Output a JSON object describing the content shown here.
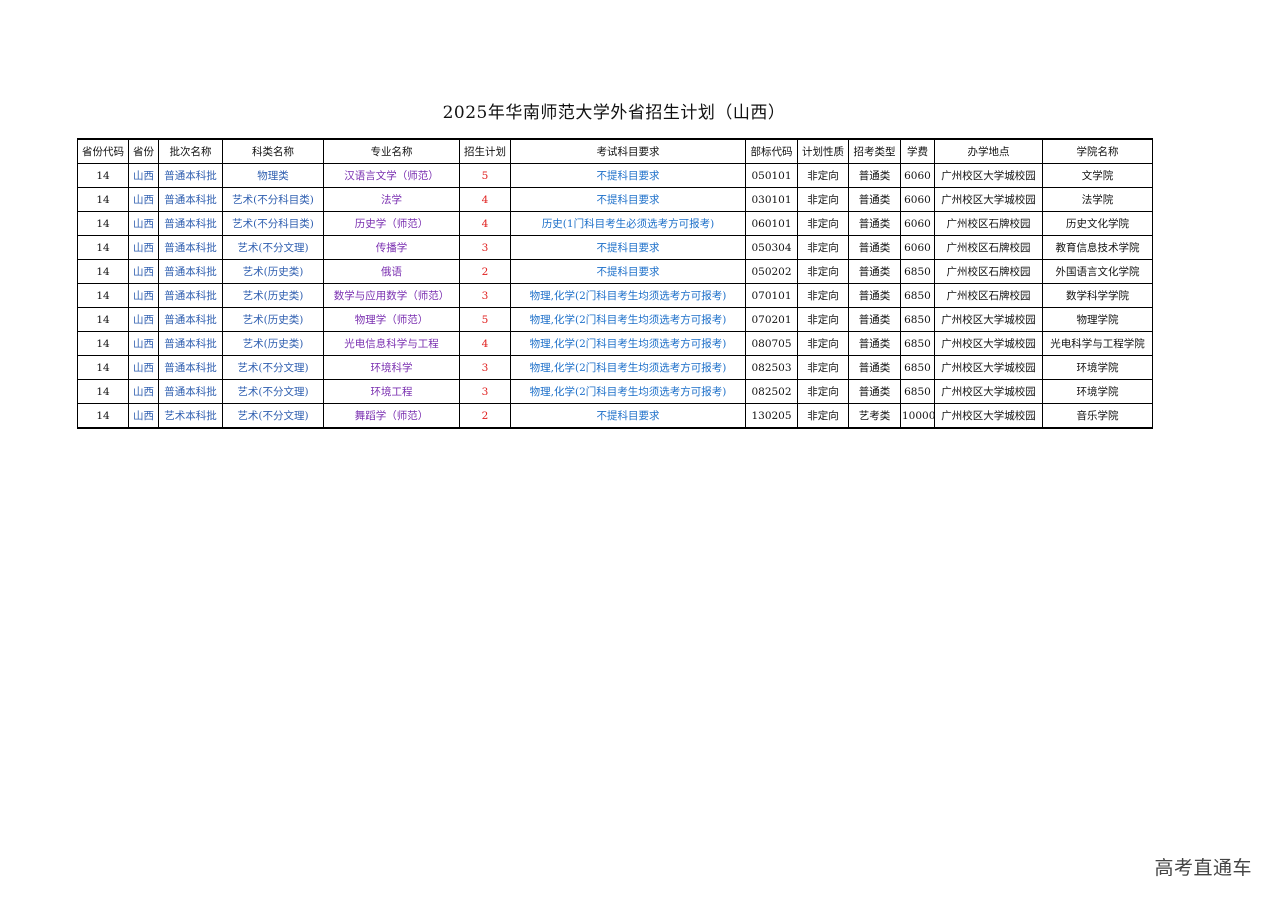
{
  "title": "2025年华南师范大学外省招生计划（山西）",
  "colors": {
    "batch": "#2f5fb0",
    "major": "#7a2fb0",
    "count": "#e0201f",
    "requirement": "#1c6fc9"
  },
  "headers": [
    "省份代码",
    "省份",
    "批次名称",
    "科类名称",
    "专业名称",
    "招生计划",
    "考试科目要求",
    "部标代码",
    "计划性质",
    "招考类型",
    "学费",
    "办学地点",
    "学院名称"
  ],
  "rows": [
    [
      "14",
      "山西",
      "普通本科批",
      "物理类",
      "汉语言文学（师范）",
      "5",
      "不提科目要求",
      "050101",
      "非定向",
      "普通类",
      "6060",
      "广州校区大学城校园",
      "文学院"
    ],
    [
      "14",
      "山西",
      "普通本科批",
      "艺术(不分科目类)",
      "法学",
      "4",
      "不提科目要求",
      "030101",
      "非定向",
      "普通类",
      "6060",
      "广州校区大学城校园",
      "法学院"
    ],
    [
      "14",
      "山西",
      "普通本科批",
      "艺术(不分科目类)",
      "历史学（师范）",
      "4",
      "历史(1门科目考生必须选考方可报考)",
      "060101",
      "非定向",
      "普通类",
      "6060",
      "广州校区石牌校园",
      "历史文化学院"
    ],
    [
      "14",
      "山西",
      "普通本科批",
      "艺术(不分文理)",
      "传播学",
      "3",
      "不提科目要求",
      "050304",
      "非定向",
      "普通类",
      "6060",
      "广州校区石牌校园",
      "教育信息技术学院"
    ],
    [
      "14",
      "山西",
      "普通本科批",
      "艺术(历史类)",
      "俄语",
      "2",
      "不提科目要求",
      "050202",
      "非定向",
      "普通类",
      "6850",
      "广州校区石牌校园",
      "外国语言文化学院"
    ],
    [
      "14",
      "山西",
      "普通本科批",
      "艺术(历史类)",
      "数学与应用数学（师范）",
      "3",
      "物理,化学(2门科目考生均须选考方可报考)",
      "070101",
      "非定向",
      "普通类",
      "6850",
      "广州校区石牌校园",
      "数学科学学院"
    ],
    [
      "14",
      "山西",
      "普通本科批",
      "艺术(历史类)",
      "物理学（师范）",
      "5",
      "物理,化学(2门科目考生均须选考方可报考)",
      "070201",
      "非定向",
      "普通类",
      "6850",
      "广州校区大学城校园",
      "物理学院"
    ],
    [
      "14",
      "山西",
      "普通本科批",
      "艺术(历史类)",
      "光电信息科学与工程",
      "4",
      "物理,化学(2门科目考生均须选考方可报考)",
      "080705",
      "非定向",
      "普通类",
      "6850",
      "广州校区大学城校园",
      "光电科学与工程学院"
    ],
    [
      "14",
      "山西",
      "普通本科批",
      "艺术(不分文理)",
      "环境科学",
      "3",
      "物理,化学(2门科目考生均须选考方可报考)",
      "082503",
      "非定向",
      "普通类",
      "6850",
      "广州校区大学城校园",
      "环境学院"
    ],
    [
      "14",
      "山西",
      "普通本科批",
      "艺术(不分文理)",
      "环境工程",
      "3",
      "物理,化学(2门科目考生均须选考方可报考)",
      "082502",
      "非定向",
      "普通类",
      "6850",
      "广州校区大学城校园",
      "环境学院"
    ],
    [
      "14",
      "山西",
      "艺术本科批",
      "艺术(不分文理)",
      "舞蹈学（师范）",
      "2",
      "不提科目要求",
      "130205",
      "非定向",
      "艺考类",
      "10000",
      "广州校区大学城校园",
      "音乐学院"
    ]
  ],
  "watermark": "高考直通车"
}
